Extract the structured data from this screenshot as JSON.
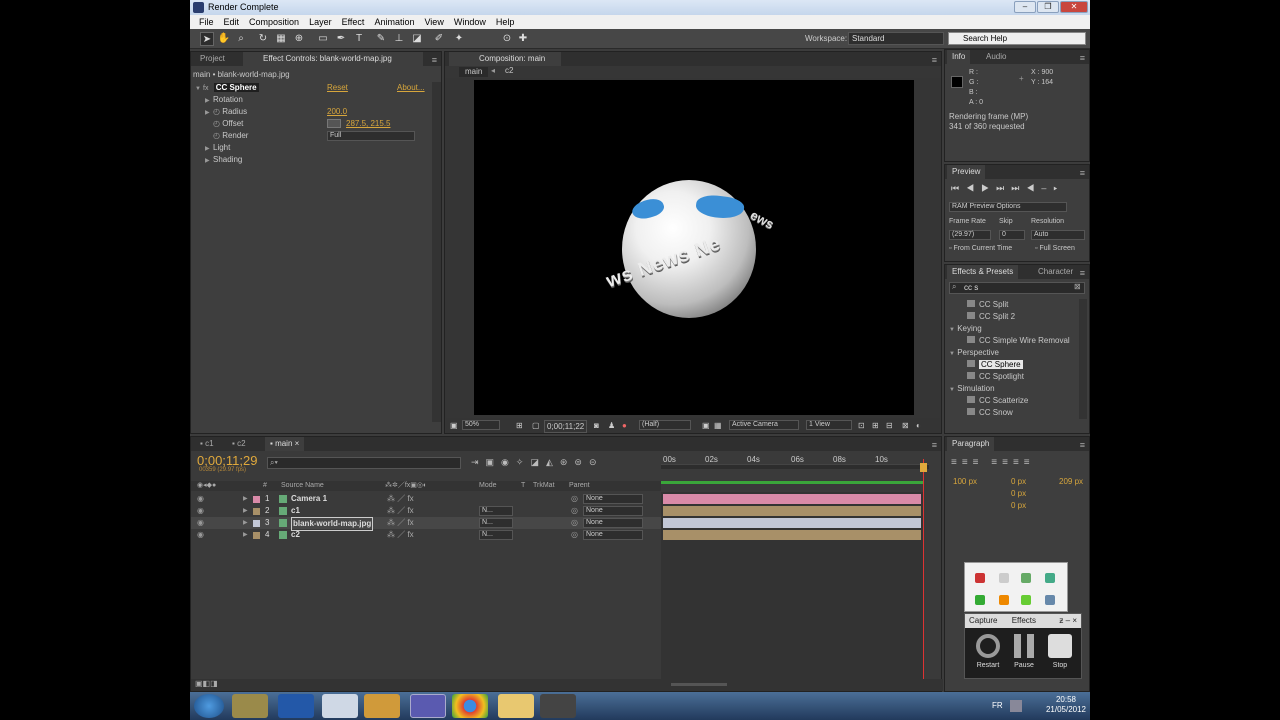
{
  "window": {
    "title": "Render Complete",
    "controls": [
      "–",
      "❐",
      "✕"
    ]
  },
  "menu": [
    "File",
    "Edit",
    "Composition",
    "Layer",
    "Effect",
    "Animation",
    "View",
    "Window",
    "Help"
  ],
  "toolbar": {
    "workspace_label": "Workspace:",
    "workspace_value": "Standard",
    "search_placeholder": "Search Help"
  },
  "project_panel": {
    "tabs": [
      "Project",
      "Effect Controls: blank-world-map.jpg"
    ],
    "breadcrumb": "main • blank-world-map.jpg",
    "effect": {
      "name": "CC Sphere",
      "reset": "Reset",
      "about": "About..."
    },
    "props": [
      {
        "label": "Rotation",
        "value": ""
      },
      {
        "label": "Radius",
        "value": "200.0"
      },
      {
        "label": "Offset",
        "value": "287.5, 215.5"
      },
      {
        "label": "Render",
        "value": "Full"
      },
      {
        "label": "Light",
        "value": ""
      },
      {
        "label": "Shading",
        "value": ""
      }
    ]
  },
  "comp_panel": {
    "tab": "Composition: main",
    "nav": [
      "main",
      "c2"
    ],
    "ring_text": "ws News Ne",
    "ring_text2": "ews",
    "bottom": {
      "zoom": "50%",
      "timecode": "0;00;11;22",
      "resolution": "(Half)",
      "camera": "Active Camera",
      "views": "1 View"
    }
  },
  "info_panel": {
    "tabs": [
      "Info",
      "Audio"
    ],
    "rgba": [
      "R :",
      "G :",
      "B :",
      "A : 0"
    ],
    "x": "X : 900",
    "y": "Y : 164",
    "status1": "Rendering frame (MP)",
    "status2": "341 of 360 requested"
  },
  "preview_panel": {
    "tab": "Preview",
    "ram": "RAM Preview Options",
    "frame_rate_label": "Frame Rate",
    "skip_label": "Skip",
    "resolution_label": "Resolution",
    "frame_rate": "(29.97)",
    "skip": "0",
    "resolution": "Auto",
    "from_current": "From Current Time",
    "full_screen": "Full Screen"
  },
  "effects_panel": {
    "tabs": [
      "Effects & Presets",
      "Character"
    ],
    "search": "cc s",
    "items": [
      {
        "label": "CC Split",
        "type": "item"
      },
      {
        "label": "CC Split 2",
        "type": "item"
      },
      {
        "label": "Keying",
        "type": "group"
      },
      {
        "label": "CC Simple Wire Removal",
        "type": "item"
      },
      {
        "label": "Perspective",
        "type": "group"
      },
      {
        "label": "CC Sphere",
        "type": "item-selected"
      },
      {
        "label": "CC Spotlight",
        "type": "item"
      },
      {
        "label": "Simulation",
        "type": "group"
      },
      {
        "label": "CC Scatterize",
        "type": "item"
      },
      {
        "label": "CC Snow",
        "type": "item"
      }
    ]
  },
  "paragraph_panel": {
    "tab": "Paragraph",
    "fields": [
      "100 px",
      "0 px",
      "209 px",
      "0 px",
      "0 px"
    ]
  },
  "timeline": {
    "tabs": [
      "c1",
      "c2",
      "main"
    ],
    "timecode": "0;00;11;29",
    "timecode_sub": "00359 (29.97 fps)",
    "headers": {
      "num": "#",
      "source": "Source Name",
      "mode": "Mode",
      "t": "T",
      "trkmat": "TrkMat",
      "parent": "Parent"
    },
    "ruler": [
      "00s",
      "02s",
      "04s",
      "06s",
      "08s",
      "10s"
    ],
    "layers": [
      {
        "num": "1",
        "name": "Camera 1",
        "mode": "",
        "parent": "None",
        "color": "#d98aa8"
      },
      {
        "num": "2",
        "name": "c1",
        "mode": "N...",
        "parent": "None",
        "color": "#a89068"
      },
      {
        "num": "3",
        "name": "blank-world-map.jpg",
        "mode": "N...",
        "parent": "None",
        "color": "#c2c7d6"
      },
      {
        "num": "4",
        "name": "c2",
        "mode": "N...",
        "parent": "None",
        "color": "#a89068"
      }
    ]
  },
  "capture_widget": {
    "tabs": [
      "Capture",
      "Effects"
    ],
    "buttons": [
      "Restart",
      "Pause",
      "Stop"
    ]
  },
  "taskbar": {
    "lang": "FR",
    "time": "20:58",
    "date": "21/05/2012"
  }
}
